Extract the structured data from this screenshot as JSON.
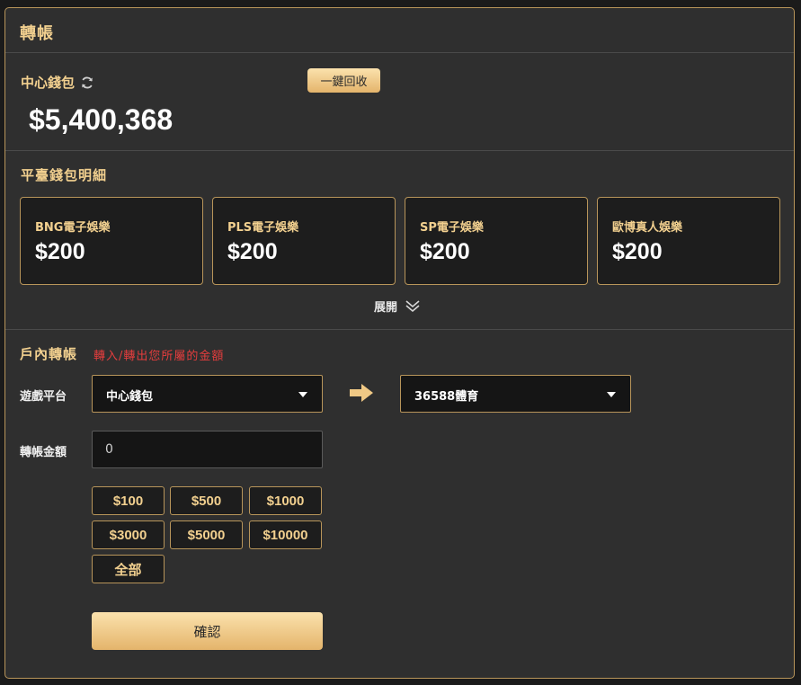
{
  "header": {
    "title": "轉帳"
  },
  "wallet": {
    "label": "中心錢包",
    "recall_button": "一鍵回收",
    "balance": "$5,400,368"
  },
  "platform_details": {
    "title": "平臺錢包明細",
    "cards": [
      {
        "name": "BNG電子娛樂",
        "amount": "$200"
      },
      {
        "name": "PLS電子娛樂",
        "amount": "$200"
      },
      {
        "name": "SP電子娛樂",
        "amount": "$200"
      },
      {
        "name": "歐博真人娛樂",
        "amount": "$200"
      }
    ],
    "expand_label": "展開"
  },
  "transfer": {
    "title": "戶內轉帳",
    "hint": "轉入/轉出您所屬的金額",
    "platform_label": "遊戲平台",
    "from_value": "中心錢包",
    "to_value": "36588體育",
    "amount_label": "轉帳金額",
    "amount_placeholder": "0",
    "quick_amounts": [
      "$100",
      "$500",
      "$1000",
      "$3000",
      "$5000",
      "$10000",
      "全部"
    ],
    "confirm_label": "確認"
  },
  "colors": {
    "accent": "#f2d08f",
    "border": "#b8955a",
    "hint": "#e43d3d",
    "panel": "#2f2f2f"
  },
  "icons": {
    "refresh": "refresh-icon",
    "expand": "double-chevron-down-icon",
    "arrow": "arrow-right-icon",
    "caret": "caret-down-icon"
  }
}
